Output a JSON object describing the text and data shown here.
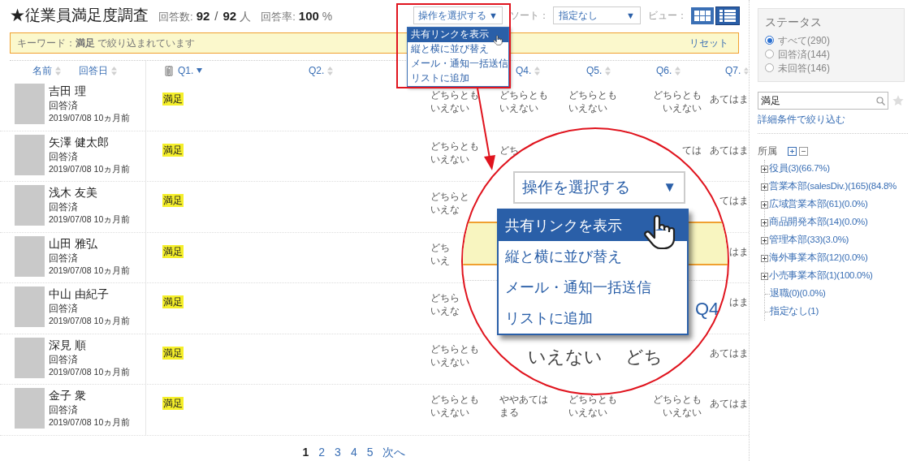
{
  "header": {
    "title": "★従業員満足度調査",
    "count_label": "回答数:",
    "answered": "92",
    "separator": "/",
    "total": "92",
    "unit": "人",
    "rate_label": "回答率:",
    "rate": "100",
    "percent": "%"
  },
  "action_select": {
    "value": "操作を選択する",
    "arrow": "▼",
    "menu": [
      {
        "label": "共有リンクを表示",
        "selected": true
      },
      {
        "label": "縦と横に並び替え",
        "selected": false
      },
      {
        "label": "メール・通知一括送信",
        "selected": false
      },
      {
        "label": "リストに追加",
        "selected": false
      }
    ]
  },
  "sort": {
    "label": "ソート：",
    "value": "指定なし",
    "arrow": "▼"
  },
  "view": {
    "label": "ビュー：",
    "options": [
      {
        "kind": "grid",
        "selected": false
      },
      {
        "kind": "list",
        "selected": true
      }
    ]
  },
  "filter_bar": {
    "text": "キーワード：**満足** で絞り込まれています",
    "reset": "リセット"
  },
  "columns": [
    {
      "label": "名前",
      "sorted_descending": false,
      "attachment": false
    },
    {
      "label": "回答日",
      "sorted_descending": false,
      "attachment": false
    },
    {
      "label": "Q1.",
      "sorted_descending": true,
      "attachment": true
    },
    {
      "label": "Q2.",
      "sorted_descending": false,
      "attachment": false
    },
    {
      "label": "Q4.",
      "sorted_descending": false,
      "attachment": false
    },
    {
      "label": "Q5.",
      "sorted_descending": false,
      "attachment": false
    },
    {
      "label": "Q6.",
      "sorted_descending": false,
      "attachment": false
    },
    {
      "label": "Q7.",
      "sorted_descending": false,
      "attachment": false
    }
  ],
  "rows": [
    {
      "name": "吉田 理",
      "status": "回答済",
      "date": "2019/07/08",
      "ago": "10ヵ月前",
      "answers": {
        "q1": {
          "lines": [
            "満足"
          ],
          "highlighted": true
        },
        "q3": {
          "lines": [
            "どちらとも",
            "いえない"
          ],
          "highlighted": false
        },
        "q4": {
          "lines": [
            "どちらとも",
            "いえない"
          ],
          "highlighted": false
        },
        "q5": {
          "lines": [
            "どちらとも",
            "いえない"
          ],
          "highlighted": false
        },
        "q6": {
          "lines": [
            "どちらとも",
            "いえない"
          ],
          "highlighted": false
        },
        "q7": {
          "lines": [
            "あてはま"
          ],
          "highlighted": false
        }
      }
    },
    {
      "name": "矢澤 健太郎",
      "status": "回答済",
      "date": "2019/07/08",
      "ago": "10ヵ月前",
      "answers": {
        "q1": {
          "lines": [
            "満足"
          ],
          "highlighted": true
        },
        "q3": {
          "lines": [
            "どちらとも",
            "いえない"
          ],
          "highlighted": false
        },
        "q4": {
          "lines": [
            "どち"
          ],
          "highlighted": false
        },
        "q6": {
          "lines": [
            "ては"
          ],
          "highlighted": false
        },
        "q7": {
          "lines": [
            "あてはま"
          ],
          "highlighted": false
        }
      }
    },
    {
      "name": "浅木 友美",
      "status": "回答済",
      "date": "2019/07/08",
      "ago": "10ヵ月前",
      "answers": {
        "q1": {
          "lines": [
            "満足"
          ],
          "highlighted": true
        },
        "q3": {
          "lines": [
            "どちらと",
            "いえな"
          ],
          "highlighted": false
        },
        "q7": {
          "lines": [
            "てはま"
          ],
          "highlighted": false
        }
      }
    },
    {
      "name": "山田 雅弘",
      "status": "回答済",
      "date": "2019/07/08",
      "ago": "10ヵ月前",
      "answers": {
        "q1": {
          "lines": [
            "満足"
          ],
          "highlighted": true
        },
        "q3": {
          "lines": [
            "どち",
            "いえ"
          ],
          "highlighted": false
        },
        "q7": {
          "lines": [
            "はま"
          ],
          "highlighted": false
        }
      }
    },
    {
      "name": "中山 由紀子",
      "status": "回答済",
      "date": "2019/07/08",
      "ago": "10ヵ月前",
      "answers": {
        "q1": {
          "lines": [
            "満足"
          ],
          "highlighted": true
        },
        "q3": {
          "lines": [
            "どちら",
            "いえな"
          ],
          "highlighted": false
        },
        "q7": {
          "lines": [
            "はま"
          ],
          "highlighted": false
        }
      }
    },
    {
      "name": "深見 順",
      "status": "回答済",
      "date": "2019/07/08",
      "ago": "10ヵ月前",
      "answers": {
        "q1": {
          "lines": [
            "満足"
          ],
          "highlighted": true
        },
        "q3": {
          "lines": [
            "どちらとも",
            "いえない"
          ],
          "highlighted": false
        },
        "q7": {
          "lines": [
            "あてはま"
          ],
          "highlighted": false
        }
      }
    },
    {
      "name": "金子 衆",
      "status": "回答済",
      "date": "2019/07/08",
      "ago": "10ヵ月前",
      "answers": {
        "q1": {
          "lines": [
            "満足"
          ],
          "highlighted": true
        },
        "q3": {
          "lines": [
            "どちらとも",
            "いえない"
          ],
          "highlighted": false
        },
        "q4": {
          "lines": [
            "ややあては",
            "まる"
          ],
          "highlighted": false
        },
        "q5": {
          "lines": [
            "どちらとも",
            "いえない"
          ],
          "highlighted": false
        },
        "q6": {
          "lines": [
            "どちらとも",
            "いえない"
          ],
          "highlighted": false
        },
        "q7": {
          "lines": [
            "あてはま"
          ],
          "highlighted": false
        }
      }
    }
  ],
  "pagination": [
    {
      "label": "1",
      "selected": true
    },
    {
      "label": "2",
      "selected": false
    },
    {
      "label": "3",
      "selected": false
    },
    {
      "label": "4",
      "selected": false
    },
    {
      "label": "5",
      "selected": false
    },
    {
      "label": "次へ",
      "selected": false
    }
  ],
  "zoom_callout": {
    "select_value": "操作を選択する",
    "arrow": "▼",
    "menu": [
      {
        "label": "共有リンクを表示",
        "selected": true
      },
      {
        "label": "縦と横に並び替え",
        "selected": false
      },
      {
        "label": "メール・通知一括送信",
        "selected": false
      },
      {
        "label": "リストに追加",
        "selected": false
      }
    ],
    "column_label": "Q4",
    "answer_text": "いえない",
    "answer_fragment": "どち"
  },
  "sidebar": {
    "status_title": "ステータス",
    "status_options": [
      {
        "label": "すべて(290)",
        "selected": true
      },
      {
        "label": "回答済(144)",
        "selected": false
      },
      {
        "label": "未回答(146)",
        "selected": false
      }
    ],
    "search_value": "満足",
    "advanced_link": "詳細条件で絞り込む",
    "group_title": "所属",
    "groups": [
      {
        "label": "役員(3)(66.7%)",
        "has_children": true
      },
      {
        "label": "営業本部(salesDiv.)(165)(84.8%",
        "has_children": true
      },
      {
        "label": "広域営業本部(61)(0.0%)",
        "has_children": true
      },
      {
        "label": "商品開発本部(14)(0.0%)",
        "has_children": true
      },
      {
        "label": "管理本部(33)(3.0%)",
        "has_children": true
      },
      {
        "label": "海外事業本部(12)(0.0%)",
        "has_children": true
      },
      {
        "label": "小売事業本部(1)(100.0%)",
        "has_children": true
      },
      {
        "label": "退職(0)(0.0%)",
        "has_children": false
      },
      {
        "label": "指定なし(1)",
        "has_children": false
      }
    ]
  }
}
